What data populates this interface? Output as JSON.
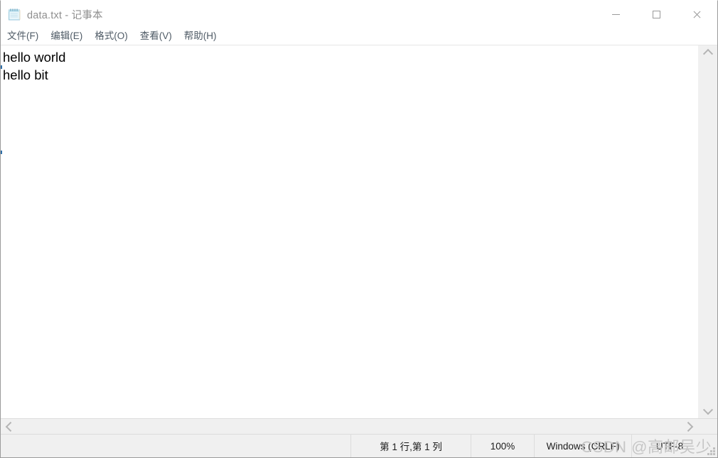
{
  "window": {
    "title": "data.txt - 记事本",
    "icon": "notepad-icon",
    "controls": {
      "minimize_label": "最小化",
      "maximize_label": "最大化",
      "close_label": "关闭"
    }
  },
  "menubar": {
    "items": [
      {
        "label": "文件(F)",
        "name": "menu-file"
      },
      {
        "label": "编辑(E)",
        "name": "menu-edit"
      },
      {
        "label": "格式(O)",
        "name": "menu-format"
      },
      {
        "label": "查看(V)",
        "name": "menu-view"
      },
      {
        "label": "帮助(H)",
        "name": "menu-help"
      }
    ]
  },
  "editor": {
    "content": "hello world\nhello bit",
    "lines": [
      "hello world",
      "hello bit"
    ]
  },
  "scrollbars": {
    "vertical": {
      "up_icon": "chevron-up-icon",
      "down_icon": "chevron-down-icon"
    },
    "horizontal": {
      "left_icon": "chevron-left-icon",
      "right_icon": "chevron-right-icon"
    }
  },
  "statusbar": {
    "cursor_position": "第 1 行,第 1 列",
    "zoom": "100%",
    "line_ending": "Windows (CRLF)",
    "encoding": "UTF-8"
  },
  "watermark": {
    "text": "CSDN @高邮吴少"
  },
  "colors": {
    "window_bg": "#ffffff",
    "title_text": "#8f8f8f",
    "menu_text": "#4f5b66",
    "status_bg": "#f0f0f0",
    "scrollbar_bg": "#f0f0f0",
    "arrow": "#b4b4b4",
    "watermark": "#c6c6c6",
    "border": "#9b9b9b"
  }
}
